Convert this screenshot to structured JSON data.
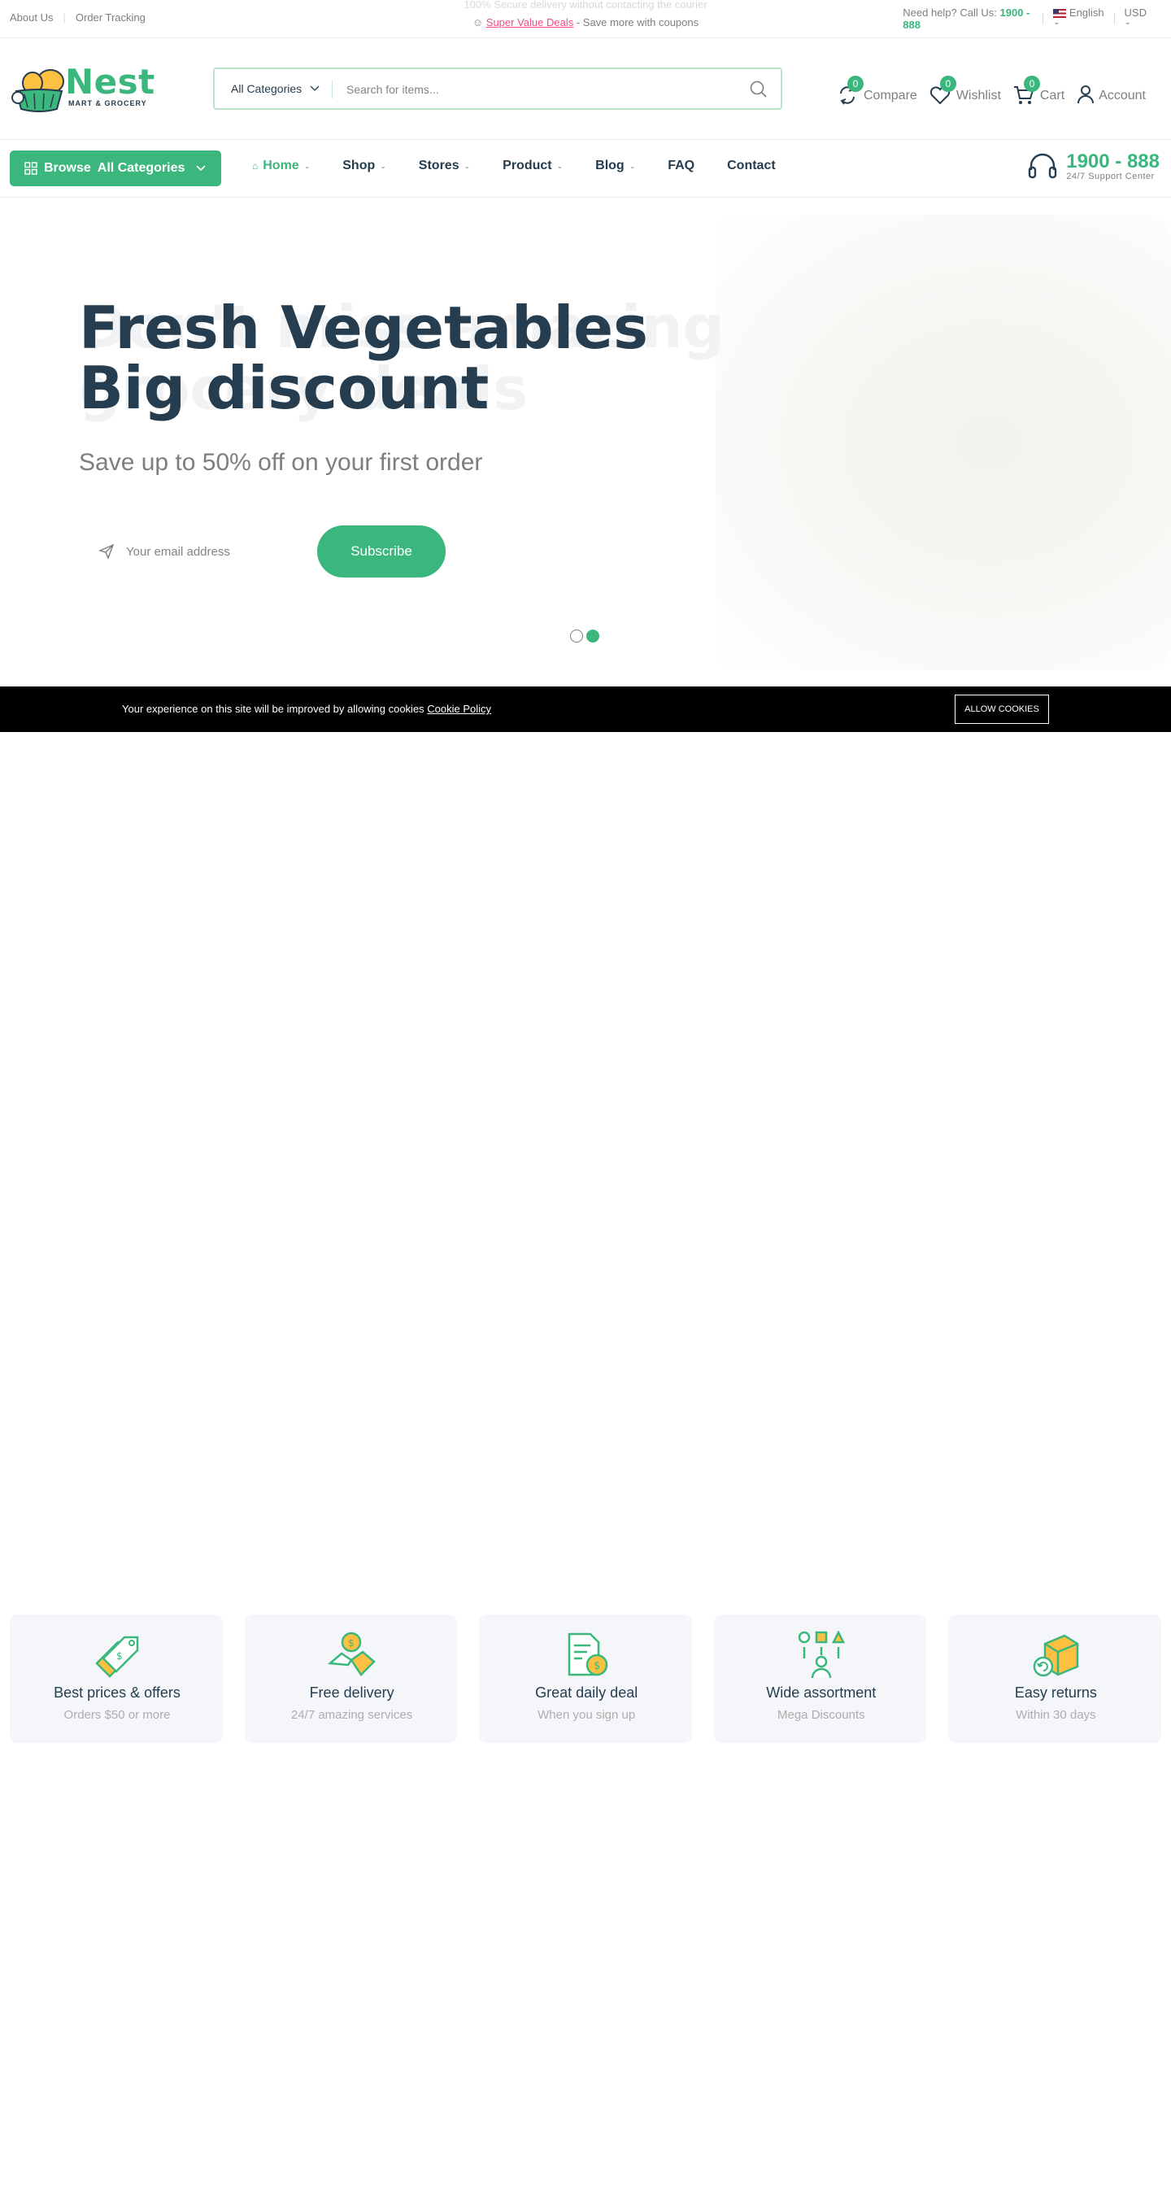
{
  "topbar": {
    "links": [
      "About Us",
      "Order Tracking"
    ],
    "ghost_message": "100% Secure delivery without contacting the courier",
    "promo_highlight": "Super Value Deals",
    "promo_rest": " - Save more with coupons",
    "help_prefix": "Need help? Call Us: ",
    "help_phone": "1900 - 888",
    "language": "English",
    "currency": "USD"
  },
  "header": {
    "logo_name": "Nest",
    "logo_tagline": "MART & GROCERY",
    "search_category": "All Categories",
    "search_placeholder": "Search for items...",
    "actions": [
      {
        "label": "Compare",
        "count": "0",
        "icon": "compare-icon"
      },
      {
        "label": "Wishlist",
        "count": "0",
        "icon": "heart-icon"
      },
      {
        "label": "Cart",
        "count": "0",
        "icon": "cart-icon"
      },
      {
        "label": "Account",
        "icon": "user-icon"
      }
    ]
  },
  "nav": {
    "browse_label": "Browse",
    "browse_strong": "All Categories",
    "items": [
      "Home",
      "Shop",
      "Stores",
      "Product",
      "Blog",
      "FAQ",
      "Contact"
    ],
    "support_number": "1900 - 888",
    "support_text": "24/7 Support Center"
  },
  "hero": {
    "title_line1": "Fresh Vegetables",
    "title_line2": "Big discount",
    "ghost_line1": "Don't miss amazing",
    "ghost_line2": "grocery deals",
    "subtitle": "Save up to 50% off on your first order",
    "email_placeholder": "Your email address",
    "button": "Subscribe",
    "slides": 2,
    "active_slide": 2
  },
  "cookie": {
    "text": "Your experience on this site will be improved by allowing cookies ",
    "link": "Cookie Policy",
    "button": "ALLOW COOKIES"
  },
  "features": [
    {
      "title": "Best prices & offers",
      "subtitle": "Orders $50 or more",
      "icon": "price-tag-icon"
    },
    {
      "title": "Free delivery",
      "subtitle": "24/7 amazing services",
      "icon": "delivery-icon"
    },
    {
      "title": "Great daily deal",
      "subtitle": "When you sign up",
      "icon": "deal-document-icon"
    },
    {
      "title": "Wide assortment",
      "subtitle": "Mega Discounts",
      "icon": "assortment-icon"
    },
    {
      "title": "Easy returns",
      "subtitle": "Within 30 days",
      "icon": "return-box-icon"
    }
  ],
  "colors": {
    "brand": "#3bb77e",
    "heading": "#253d4e",
    "muted": "#7e7e7e",
    "promo": "#f74b81"
  }
}
